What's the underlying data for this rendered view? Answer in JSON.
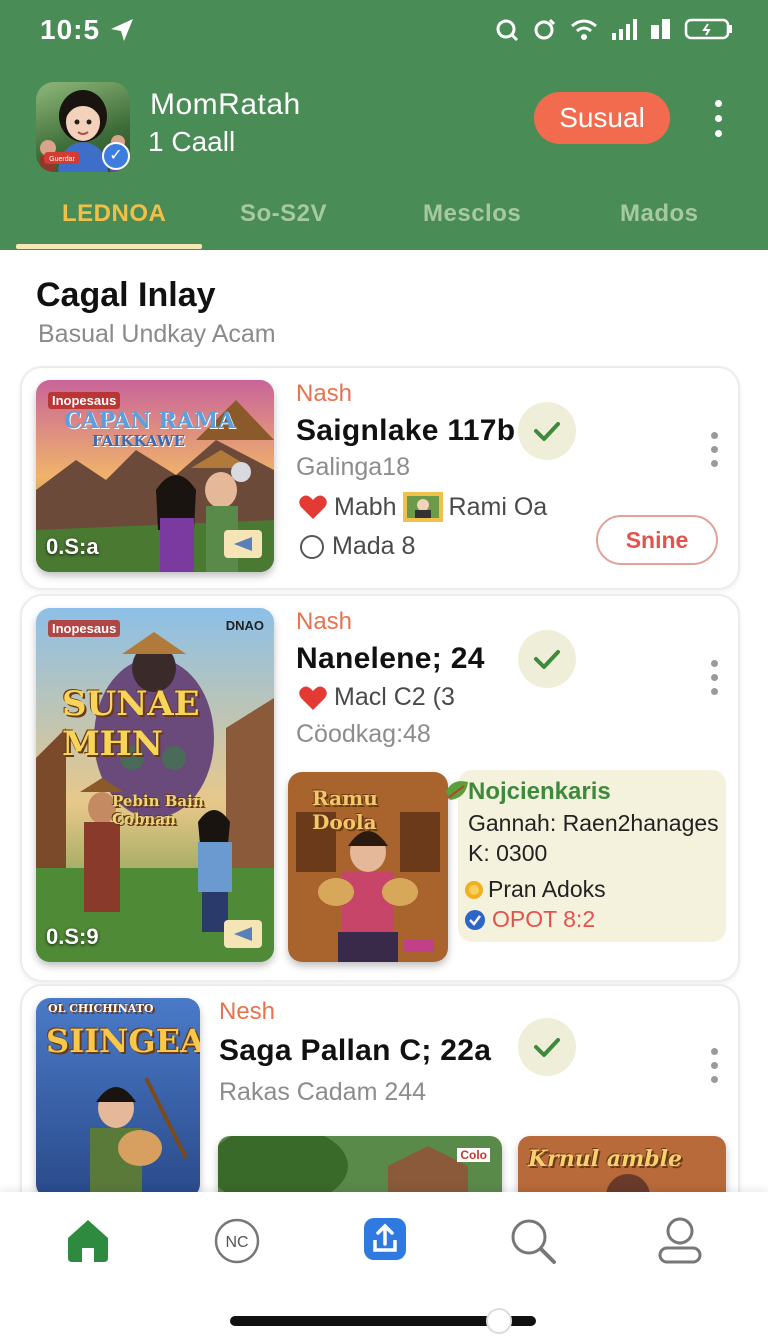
{
  "status_bar": {
    "time": "10:5"
  },
  "header": {
    "user_name": "MomRatah",
    "user_sub": "1 Caall",
    "action_button": "Susual",
    "avatar_caption": "Guerdar"
  },
  "tabs": [
    {
      "label": "LEDNOA",
      "active": true
    },
    {
      "label": "So-S2V",
      "active": false
    },
    {
      "label": "Mesclos",
      "active": false
    },
    {
      "label": "Mados",
      "active": false
    }
  ],
  "section": {
    "title": "Cagal Inlay",
    "subtitle": "Basual Undkay Acam"
  },
  "cards": [
    {
      "thumb_title_1": "CAPAN RAMA",
      "thumb_title_2": "FAIKKAWE",
      "thumb_brand": "Inopesaus",
      "thumb_time": "0.S:a",
      "kind": "Nash",
      "title": "Saignlake 117b",
      "meta": "Galinga18",
      "line1_text": "Mabh",
      "line1_extra": "Rami Oa",
      "line2_text": "Mada 8",
      "button": "Snine"
    },
    {
      "thumb_title": "SUNAE MHN",
      "thumb_sub": "Pebin Bain Cobnan",
      "thumb_brand": "Inopesaus",
      "thumb_brand_right": "DNAO",
      "thumb_time": "0.S:9",
      "kind": "Nash",
      "title": "Nanelene;  24",
      "line1_text": "Macl C2 (3",
      "meta": "Cöodkag:48",
      "sub_thumb_title": "Ramu Doola",
      "info_title": "Nojcienkaris",
      "info_line1": "Gannah: Raen2hanages",
      "info_line2": "K: 0300",
      "info_line3": "Pran Adoks",
      "info_line4": "OPOT 8:2"
    },
    {
      "thumb_title": "SIINGEAS",
      "thumb_brand": "OL CHICHINATO",
      "kind": "Nesh",
      "title": "Saga Pallan C; 22a",
      "meta": "Rakas Cadam 244",
      "thumb2_label": "Colo",
      "thumb3_title": "Krnul amble"
    }
  ],
  "bottom_nav": [
    {
      "icon": "home-icon",
      "label": ""
    },
    {
      "icon": "nc-icon",
      "label": "NC"
    },
    {
      "icon": "share-icon",
      "label": ""
    },
    {
      "icon": "search-icon",
      "label": ""
    },
    {
      "icon": "profile-icon",
      "label": ""
    }
  ],
  "colors": {
    "header_green": "#4a8c56",
    "accent_orange": "#f26b4e",
    "tab_active": "#f0c04a",
    "kind_orange": "#e8724e",
    "check_green": "#3d8a3d"
  }
}
